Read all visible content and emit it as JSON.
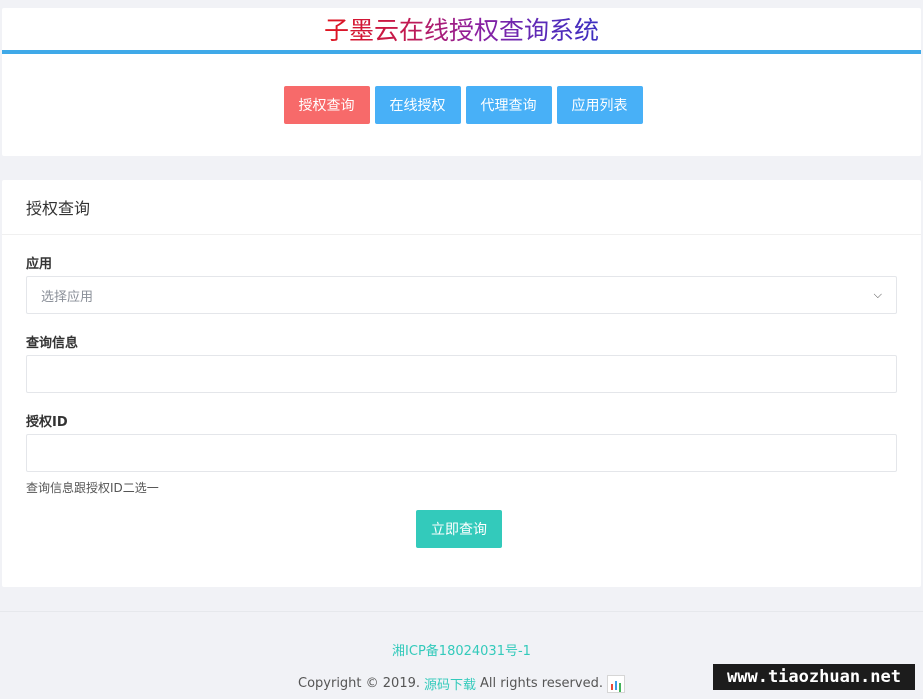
{
  "header": {
    "title": "子墨云在线授权查询系统",
    "nav": [
      {
        "label": "授权查询",
        "style": "danger"
      },
      {
        "label": "在线授权",
        "style": "info"
      },
      {
        "label": "代理查询",
        "style": "info"
      },
      {
        "label": "应用列表",
        "style": "info"
      }
    ]
  },
  "form": {
    "card_title": "授权查询",
    "app_label": "应用",
    "app_selected": "选择应用",
    "query_label": "查询信息",
    "query_value": "",
    "auth_id_label": "授权ID",
    "auth_id_value": "",
    "hint": "查询信息跟授权ID二选一",
    "submit_label": "立即查询"
  },
  "footer": {
    "icp": "湘ICP备18024031号-1",
    "copyright_prefix": "Copyright © 2019.",
    "copyright_link": "源码下载",
    "copyright_suffix": "All rights reserved.",
    "stats_icon": "cnzz-stats-icon"
  },
  "watermark": "www.tiaozhuan.net",
  "colors": {
    "accent_blue": "#48b0f7",
    "danger": "#f76a6a",
    "primary_teal": "#33cabb",
    "title_bar": "#3fa9e8"
  }
}
